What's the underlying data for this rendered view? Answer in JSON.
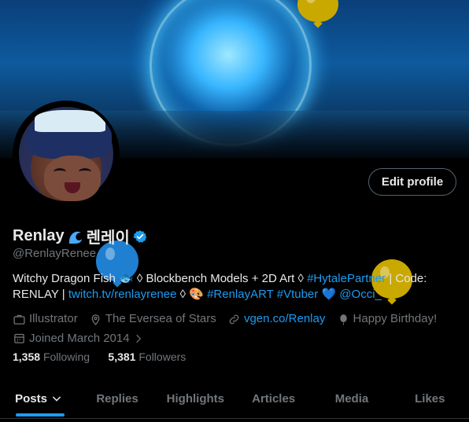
{
  "profile": {
    "name": "Renlay",
    "name_suffix": "렌레이",
    "handle": "@RenlayRenee",
    "edit_button": "Edit profile",
    "bio": {
      "line1_text": "Witchy Dragon Fish",
      "line1_mid": "◊ Blockbench Models + 2D Art ◊",
      "line1_tag": "#HytalePartner",
      "line1_end": "| Code:",
      "line2_start": "RENLAY |",
      "line2_link": "twitch.tv/renlayrenee",
      "line2_mid": "◊ 🎨",
      "line2_tag1": "#RenlayART",
      "line2_tag2": "#Vtuber",
      "line2_heart": "💙",
      "line2_mention": "@Occi_"
    },
    "meta": {
      "profession": "Illustrator",
      "location": "The Eversea of Stars",
      "website": "vgen.co/Renlay",
      "birthday": "Happy Birthday!",
      "joined": "Joined March 2014"
    },
    "counts": {
      "following_num": "1,358",
      "following_label": "Following",
      "followers_num": "5,381",
      "followers_label": "Followers"
    }
  },
  "tabs": [
    {
      "label": "Posts"
    },
    {
      "label": "Replies"
    },
    {
      "label": "Highlights"
    },
    {
      "label": "Articles"
    },
    {
      "label": "Media"
    },
    {
      "label": "Likes"
    }
  ],
  "colors": {
    "accent": "#1d9bf0",
    "muted": "#71767b",
    "balloon_gold": "#c9a800",
    "balloon_blue": "#1f7fd0"
  }
}
